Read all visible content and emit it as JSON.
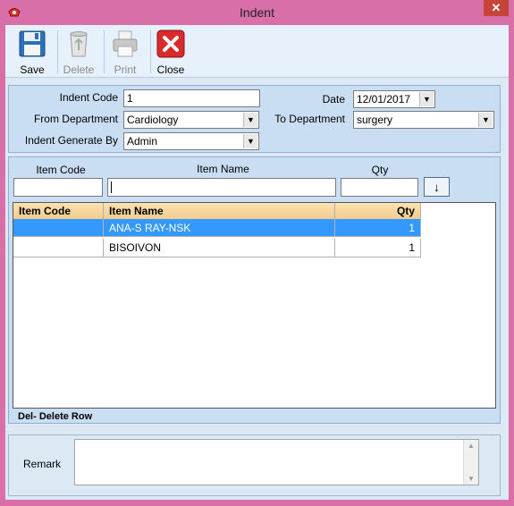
{
  "window": {
    "title": "Indent",
    "close_glyph": "✕"
  },
  "toolbar": {
    "save_label": "Save",
    "delete_label": "Delete",
    "print_label": "Print",
    "close_label": "Close"
  },
  "form": {
    "indent_code_label": "Indent Code",
    "indent_code_value": "1",
    "date_label": "Date",
    "date_value": "12/01/2017",
    "from_department_label": "From Department",
    "from_department_value": "Cardiology",
    "to_department_label": "To Department",
    "to_department_value": "surgery",
    "indent_generate_by_label": "Indent Generate By",
    "indent_generate_by_value": "Admin"
  },
  "entry": {
    "item_code_label": "Item Code",
    "item_name_label": "Item Name",
    "qty_label": "Qty",
    "item_code_value": "",
    "item_name_value": "",
    "qty_value": "",
    "add_glyph": "↓"
  },
  "grid": {
    "columns": [
      "Item Code",
      "Item Name",
      "Qty"
    ],
    "rows": [
      {
        "item_code": "",
        "item_name": "ANA-S RAY-NSK",
        "qty": "1",
        "selected": true
      },
      {
        "item_code": "",
        "item_name": "BISOIVON",
        "qty": "1",
        "selected": false
      }
    ],
    "hint": "Del- Delete Row"
  },
  "remark": {
    "label": "Remark",
    "value": ""
  },
  "colors": {
    "window_frame": "#d86fa8",
    "panel": "#c9def2",
    "selection": "#3399ff",
    "grid_header": "#f2cc8c"
  }
}
